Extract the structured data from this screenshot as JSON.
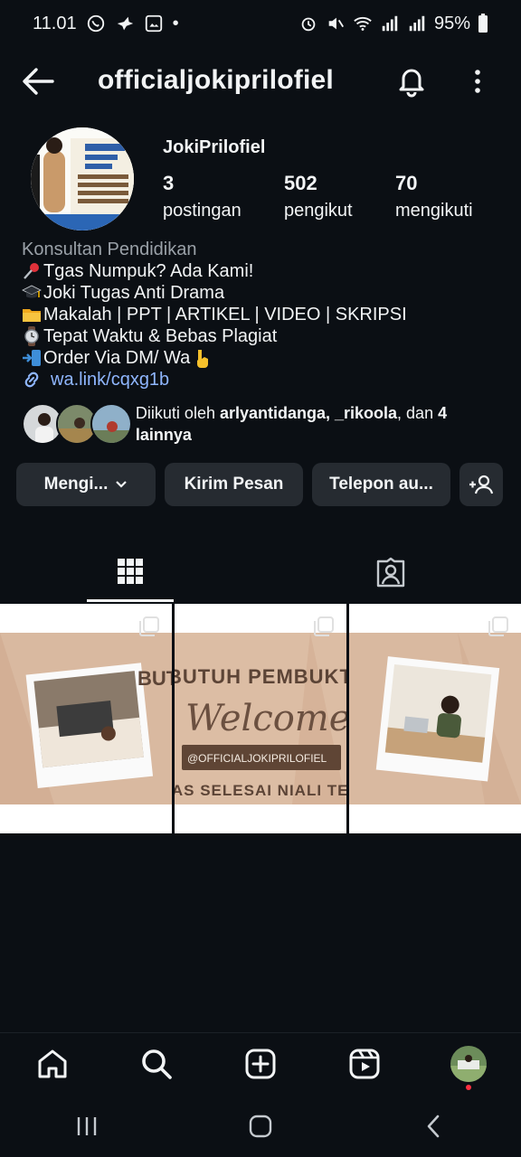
{
  "status_bar": {
    "time": "11.01",
    "battery": "95%"
  },
  "header": {
    "username": "officialjokiprilofiel"
  },
  "profile": {
    "display_name": "JokiPrilofiel",
    "stats": [
      {
        "value": "3",
        "label": "postingan"
      },
      {
        "value": "502",
        "label": "pengikut"
      },
      {
        "value": "70",
        "label": "mengikuti"
      }
    ],
    "category": "Konsultan Pendidikan",
    "bio_lines": [
      {
        "emoji": "pushpin",
        "text": "Tgas Numpuk? Ada Kami!"
      },
      {
        "emoji": "graduation-cap",
        "text": "Joki Tugas Anti Drama"
      },
      {
        "emoji": "folder",
        "text": "Makalah | PPT | ARTIKEL | VIDEO | SKRIPSI"
      },
      {
        "emoji": "watch",
        "text": " Tepat Waktu & Bebas Plagiat"
      },
      {
        "emoji": "phone-arrow",
        "text": "Order Via DM/ Wa"
      }
    ],
    "link": "wa.link/cqxg1b",
    "followed_by": {
      "prefix": "Diikuti oleh ",
      "names": "arlyantidanga, _rikoola",
      "middle": ", dan ",
      "suffix": "4 lainnya"
    }
  },
  "actions": {
    "following_label": "Mengi...",
    "message_label": "Kirim Pesan",
    "call_label": "Telepon au..."
  },
  "posts": {
    "banner_heading": "BUTUH PEMBUKTIAN?",
    "banner_script": "Welcome",
    "banner_handle": "@OFFICIALJOKIPRILOFIEL",
    "banner_footer": "TUGAS SELESAI NIALI TERJAMIN"
  },
  "colors": {
    "background": "#0b0f14",
    "button": "#262b31",
    "link": "#8fb6ff",
    "muted": "#9aa1a8",
    "notification_dot": "#ff3040",
    "banner_beige": "#d9b9a0"
  }
}
